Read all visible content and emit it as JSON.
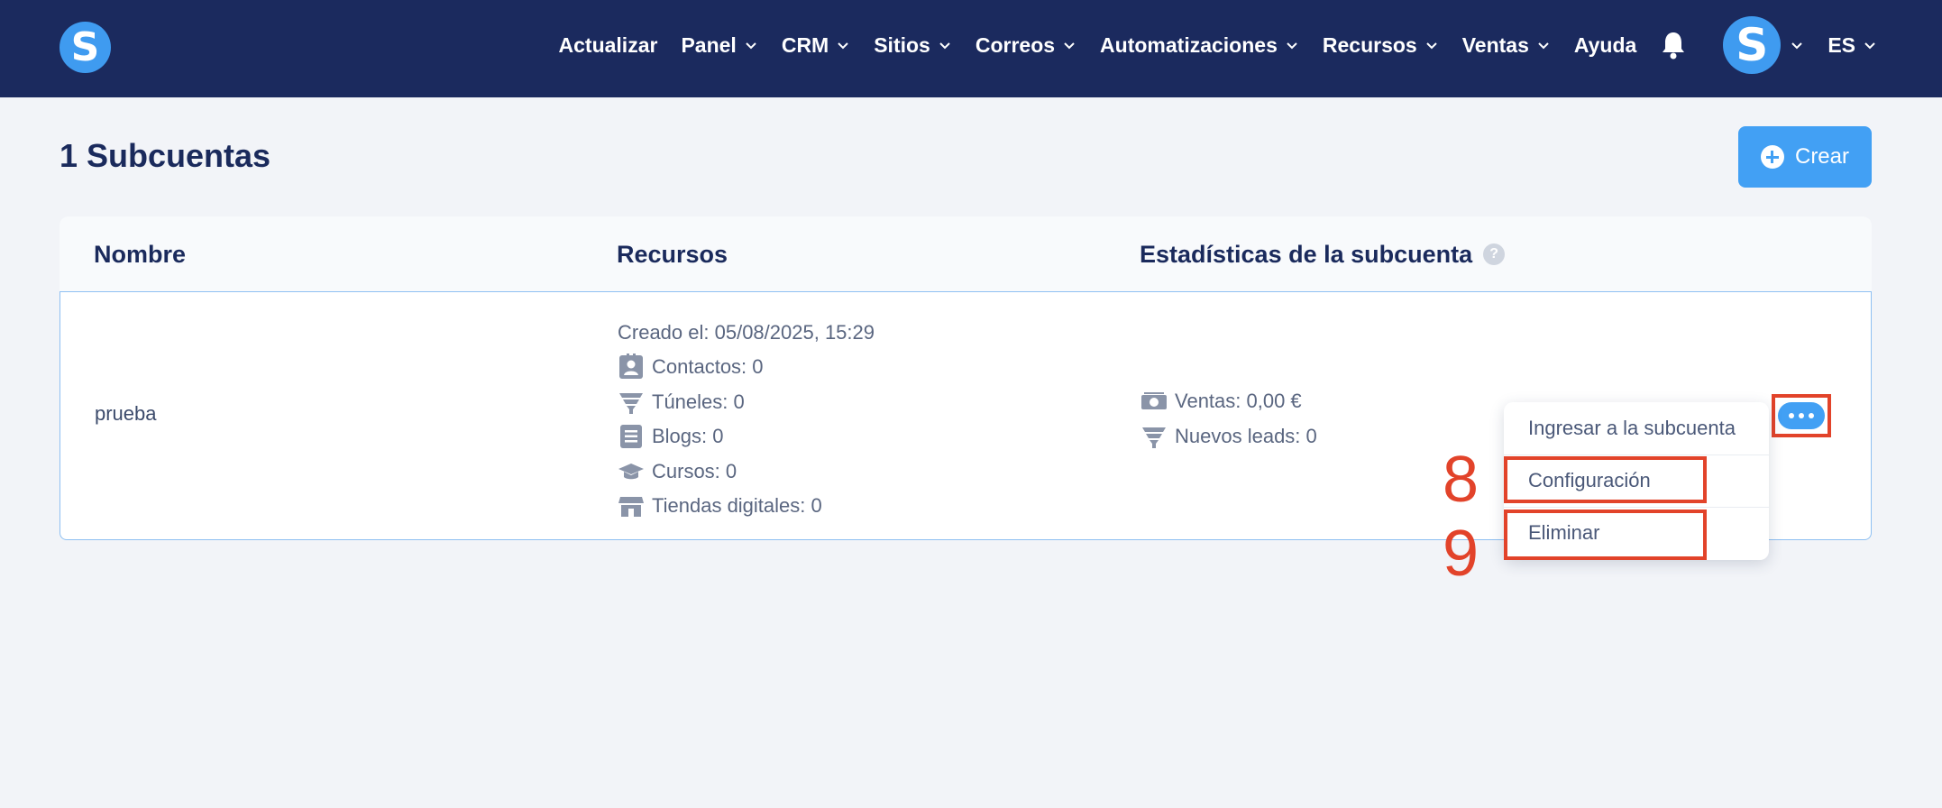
{
  "nav": {
    "logo_letter": "S",
    "items": [
      {
        "label": "Actualizar",
        "dropdown": false
      },
      {
        "label": "Panel",
        "dropdown": true
      },
      {
        "label": "CRM",
        "dropdown": true
      },
      {
        "label": "Sitios",
        "dropdown": true
      },
      {
        "label": "Correos",
        "dropdown": true
      },
      {
        "label": "Automatizaciones",
        "dropdown": true
      },
      {
        "label": "Recursos",
        "dropdown": true
      },
      {
        "label": "Ventas",
        "dropdown": true
      },
      {
        "label": "Ayuda",
        "dropdown": false
      }
    ],
    "avatar_letter": "S",
    "language": "ES"
  },
  "page": {
    "title": "1 Subcuentas",
    "create_label": "Crear"
  },
  "table": {
    "headers": {
      "name": "Nombre",
      "resources": "Recursos",
      "stats": "Estadísticas de la subcuenta",
      "help": "?"
    },
    "rows": [
      {
        "name": "prueba",
        "created": "Creado el: 05/08/2025, 15:29",
        "resources": [
          {
            "icon": "contact-card-icon",
            "label": "Contactos: 0"
          },
          {
            "icon": "funnel-icon",
            "label": "Túneles: 0"
          },
          {
            "icon": "blog-document-icon",
            "label": "Blogs: 0"
          },
          {
            "icon": "graduation-cap-icon",
            "label": "Cursos: 0"
          },
          {
            "icon": "store-icon",
            "label": "Tiendas digitales: 0"
          }
        ],
        "stats": [
          {
            "icon": "money-icon",
            "label": "Ventas: 0,00 €"
          },
          {
            "icon": "funnel-icon",
            "label": "Nuevos leads: 0"
          }
        ]
      }
    ]
  },
  "dropdown": {
    "items": [
      "Ingresar a la subcuenta",
      "Configuración",
      "Eliminar"
    ]
  },
  "annotations": {
    "step_8": "8",
    "step_9": "9",
    "color": "#e2432a"
  },
  "colors": {
    "navbar": "#1b2a5e",
    "accent": "#42a0f4",
    "background": "#f2f4f8"
  }
}
